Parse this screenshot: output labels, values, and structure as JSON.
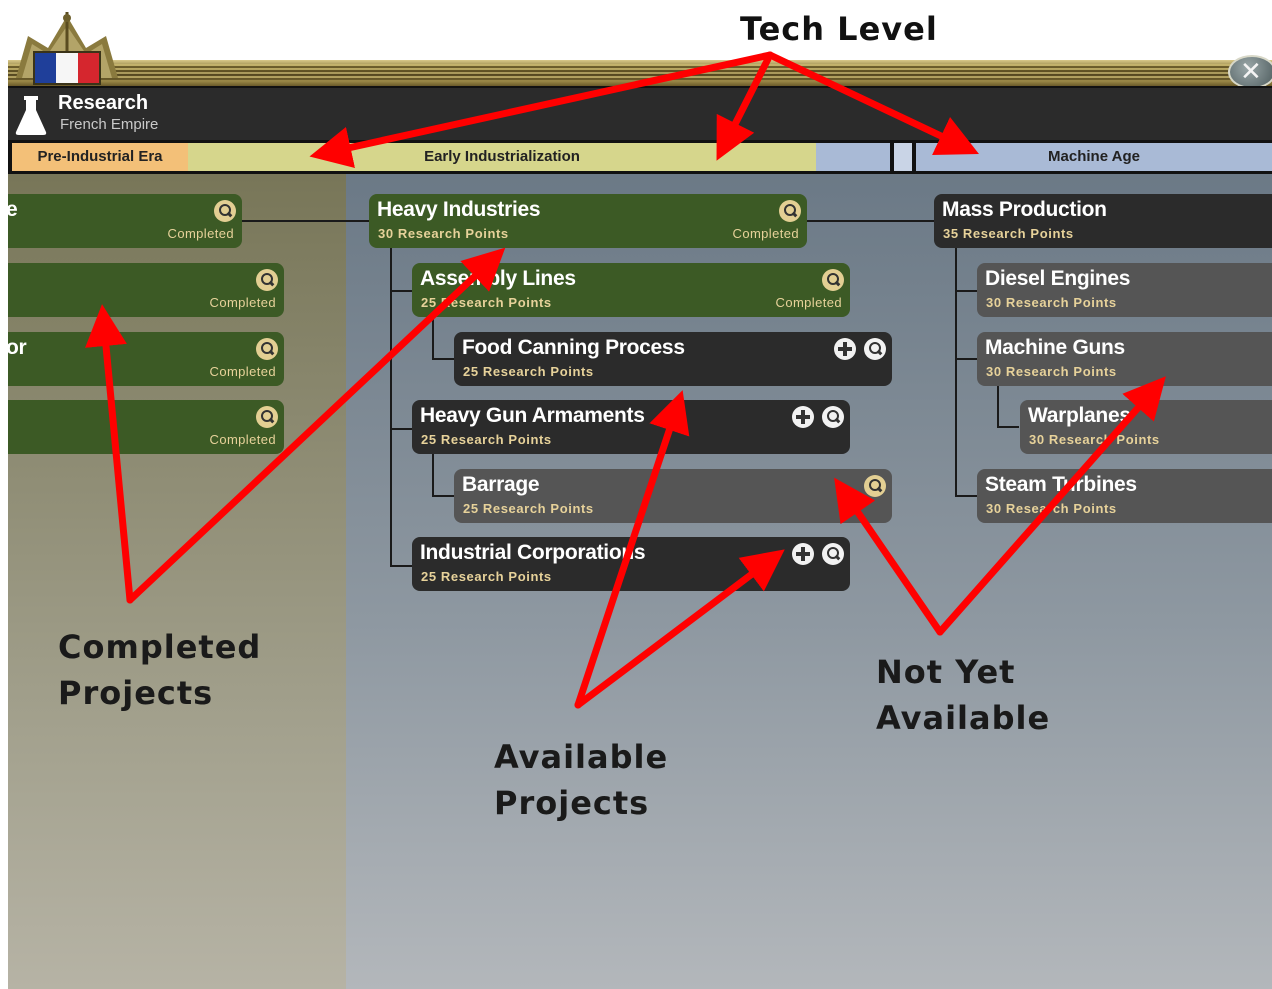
{
  "annotations": {
    "tech_level": "Tech Level",
    "completed_line1": "Completed",
    "completed_line2": "Projects",
    "available_line1": "Available",
    "available_line2": "Projects",
    "notyet_line1": "Not Yet",
    "notyet_line2": "Available"
  },
  "header": {
    "title": "Research",
    "subtitle": "French Empire",
    "close_glyph": "✕"
  },
  "eras": [
    "Pre-Industrial Era",
    "Early Industrialization",
    "Machine Age"
  ],
  "left_nodes": [
    {
      "title": "e",
      "status": "Completed"
    },
    {
      "title": "",
      "status": "Completed"
    },
    {
      "title": "or",
      "status": "Completed"
    },
    {
      "title": "",
      "status": "Completed"
    }
  ],
  "nodes": {
    "heavy_industries": {
      "title": "Heavy Industries",
      "points": "30 Research Points",
      "status": "Completed"
    },
    "assembly_lines": {
      "title": "Assembly Lines",
      "points": "25 Research Points",
      "status": "Completed"
    },
    "food_canning": {
      "title": "Food Canning Process",
      "points": "25 Research Points"
    },
    "heavy_gun": {
      "title": "Heavy Gun Armaments",
      "points": "25 Research Points"
    },
    "barrage": {
      "title": "Barrage",
      "points": "25 Research Points"
    },
    "industrial_corp": {
      "title": "Industrial Corporations",
      "points": "25 Research Points"
    },
    "mass_production": {
      "title": "Mass Production",
      "points": "35 Research Points"
    },
    "diesel_engines": {
      "title": "Diesel Engines",
      "points": "30 Research Points"
    },
    "machine_guns": {
      "title": "Machine Guns",
      "points": "30 Research Points"
    },
    "warplanes": {
      "title": "Warplanes",
      "points": "30 Research Points"
    },
    "steam_turbines": {
      "title": "Steam Turbines",
      "points": "30 Research Points"
    }
  },
  "colors": {
    "completed_node": "#3c5a25",
    "available_node": "#2b2b2b",
    "locked_node": "#555555",
    "arrow": "#ff0000"
  },
  "icons": [
    "flask-icon",
    "close-icon",
    "magnifier-icon",
    "add-icon",
    "flag-emblem-icon"
  ]
}
